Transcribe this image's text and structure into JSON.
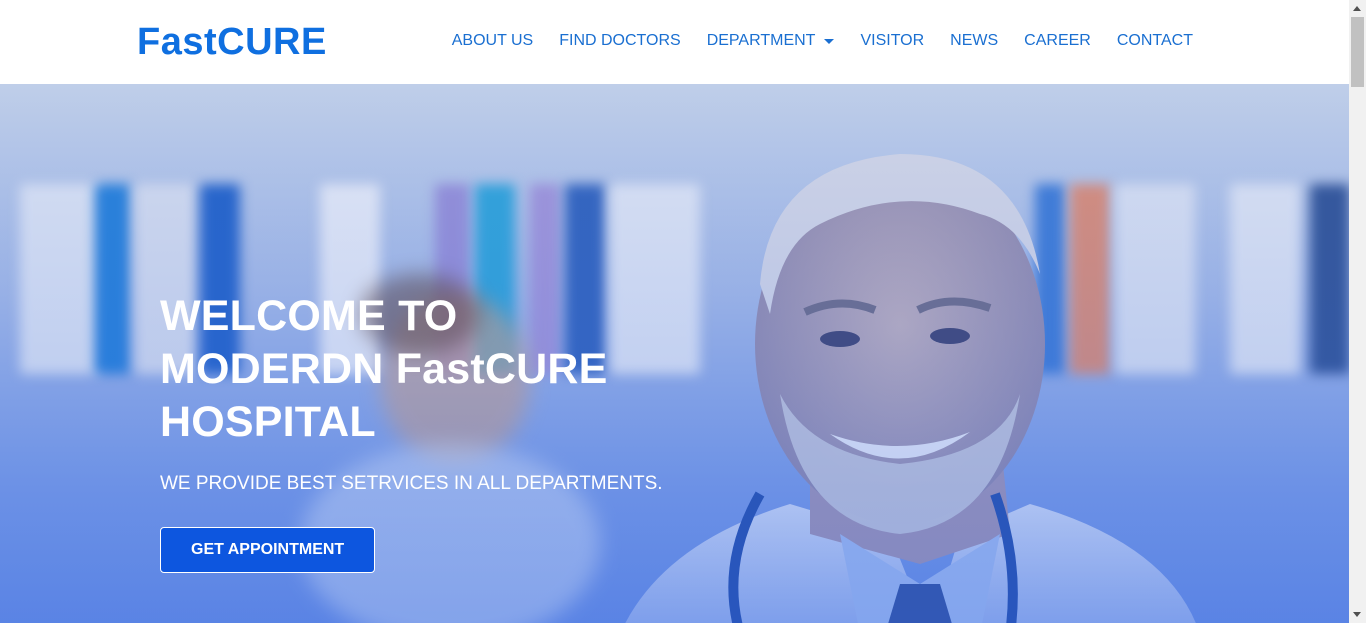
{
  "navbar": {
    "brand": "FastCURE",
    "items": [
      {
        "label": "ABOUT US"
      },
      {
        "label": "FIND DOCTORS"
      },
      {
        "label": "DEPARTMENT",
        "has_dropdown": true
      },
      {
        "label": "VISITOR"
      },
      {
        "label": "NEWS"
      },
      {
        "label": "CAREER"
      },
      {
        "label": "CONTACT"
      }
    ]
  },
  "hero": {
    "title_line1": "WELCOME TO",
    "title_line2": "MODERDN FastCURE",
    "title_line3": "HOSPITAL",
    "subtitle": "WE PROVIDE BEST SETRVICES IN ALL DEPARTMENTS.",
    "cta_label": "GET APPOINTMENT"
  },
  "colors": {
    "brand": "#0f6fe0",
    "nav_link": "#1a6fd1",
    "cta_bg": "#0d56df",
    "hero_overlay": "#6a8fe4"
  }
}
